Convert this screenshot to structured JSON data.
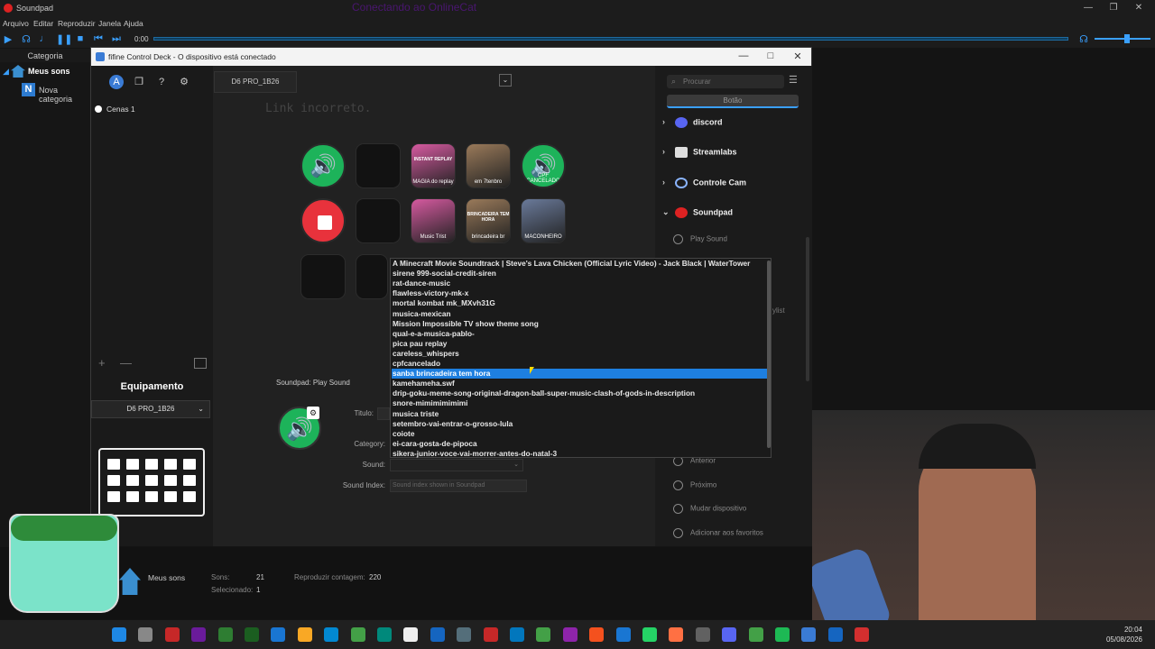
{
  "soundpad": {
    "title": "Soundpad",
    "ghost_title": "Conectando ao OnlineCat",
    "menu": [
      "Arquivo",
      "Editar",
      "Reproduzir",
      "Janela",
      "Ajuda"
    ],
    "time": "0:00",
    "sidebar_header": "Categoria",
    "category_main": "Meus sons",
    "category_new": "Nova categoria",
    "status": {
      "folder": "Meus sons",
      "sounds_label": "Sons:",
      "sounds_value": "21",
      "selected_label": "Selecionado:",
      "selected_value": "1",
      "play_count_label": "Reproduzir contagem:",
      "play_count_value": "220"
    }
  },
  "deck": {
    "title": "fifine Control Deck - O dispositivo está conectado",
    "scene": "Cenas 1",
    "device_tab": "D6 PRO_1B26",
    "link_text": "Link incorreto.",
    "equipment_label": "Equipamento",
    "equipment_value": "D6 PRO_1B26",
    "action_title": "Soundpad: Play Sound",
    "fields": {
      "title_label": "Titulo:",
      "category_label": "Category:",
      "sound_label": "Sound:",
      "index_label": "Sound Index:",
      "index_placeholder": "Sound index shown in Soundpad"
    },
    "keys": [
      {
        "type": "sound",
        "label": ""
      },
      {
        "type": "empty",
        "label": ""
      },
      {
        "type": "image",
        "label": "MAGIA do replay",
        "caption": "INSTANT REPLAY"
      },
      {
        "type": "image",
        "label": "em 7tenbro"
      },
      {
        "type": "sound",
        "label": "CPF CANCELADO"
      },
      {
        "type": "stop",
        "label": ""
      },
      {
        "type": "empty",
        "label": ""
      },
      {
        "type": "image",
        "label": "Music Trist"
      },
      {
        "type": "image",
        "label": "brincadeira br",
        "caption": "BRINCADEIRA TEM HORA"
      },
      {
        "type": "image",
        "label": "MACONHEIRO"
      }
    ],
    "right": {
      "search_placeholder": "Procurar",
      "tab_label": "Botão",
      "plugins": [
        "discord",
        "Streamlabs",
        "Controle Cam",
        "Soundpad"
      ],
      "actions": [
        "Play Sound",
        "Anterior",
        "Próximo",
        "Mudar dispositivo",
        "Adicionar aos favoritos"
      ],
      "partial": "ylist"
    }
  },
  "dropdown": {
    "selected_index": 11,
    "items": [
      "A Minecraft Movie Soundtrack | Steve's Lava Chicken (Official Lyric Video) - Jack Black | WaterTower",
      "sirene 999-social-credit-siren",
      "rat-dance-music",
      "flawless-victory-mk-x",
      "mortal kombat mk_MXvh31G",
      "musica-mexican",
      "Mission Impossible TV show theme song",
      "qual-e-a-musica-pablo-",
      "pica pau replay",
      "careless_whispers",
      "cpfcancelado",
      "sanba brincadeira tem hora",
      "kamehameha.swf",
      "drip-goku-meme-song-original-dragon-ball-super-music-clash-of-gods-in-description",
      "snore-mimimimimimi",
      "musica triste",
      "setembro-vai-entrar-o-grosso-lula",
      "coiote",
      "ei-cara-gosta-de-pipoca",
      "sikera-junior-voce-vai-morrer-antes-do-natal-3"
    ]
  },
  "clock": {
    "time": "20:04",
    "date": "05/08/2026"
  },
  "colors": {
    "accent": "#1e7fe0",
    "green_key": "#1db35a",
    "red_key": "#e8323c"
  }
}
